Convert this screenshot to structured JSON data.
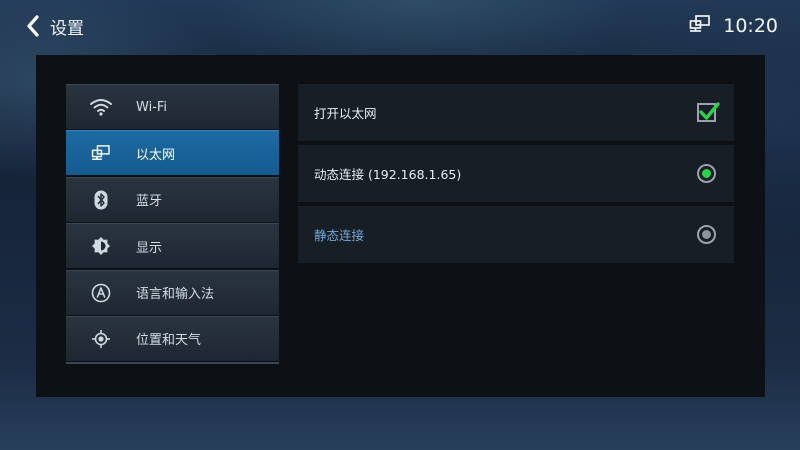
{
  "header": {
    "title": "设置",
    "time": "10:20",
    "back_icon": "chevron-left-icon",
    "network_icon": "ethernet-icon"
  },
  "sidebar": {
    "items": [
      {
        "label": "Wi-Fi",
        "icon": "wifi-icon",
        "active": false
      },
      {
        "label": "以太网",
        "icon": "ethernet-icon",
        "active": true
      },
      {
        "label": "蓝牙",
        "icon": "bluetooth-icon",
        "active": false
      },
      {
        "label": "显示",
        "icon": "brightness-icon",
        "active": false
      },
      {
        "label": "语言和输入法",
        "icon": "language-icon",
        "active": false
      },
      {
        "label": "位置和天气",
        "icon": "location-icon",
        "active": false
      }
    ]
  },
  "main": {
    "rows": [
      {
        "label": "打开以太网",
        "control": "checkbox",
        "checked": true
      },
      {
        "label": "动态连接 (192.168.1.65)",
        "control": "radio",
        "selected": true
      },
      {
        "label": "静态连接",
        "control": "radio",
        "selected": false
      }
    ]
  },
  "colors": {
    "accent": "#1d6aa3",
    "check_green": "#2bd14a",
    "radio_on": "#2bd14a",
    "radio_off": "#8d949c"
  }
}
